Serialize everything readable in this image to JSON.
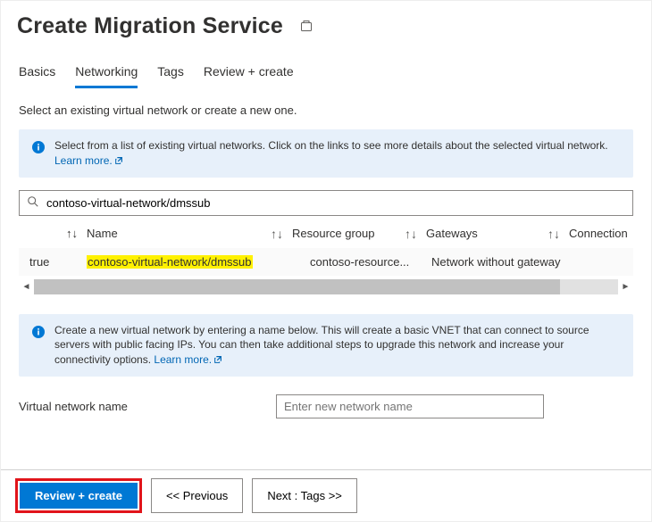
{
  "header": {
    "title": "Create Migration Service"
  },
  "tabs": {
    "basics": "Basics",
    "networking": "Networking",
    "tags": "Tags",
    "review": "Review + create"
  },
  "intro": "Select an existing virtual network or create a new one.",
  "info1": {
    "text": "Select from a list of existing virtual networks. Click on the links to see more details about the selected virtual network.",
    "link": "Learn more."
  },
  "search": {
    "value": "contoso-virtual-network/dmssub"
  },
  "table": {
    "headers": {
      "name": "Name",
      "rg": "Resource group",
      "gw": "Gateways",
      "conn": "Connections"
    },
    "row": {
      "col0": "true",
      "name": "contoso-virtual-network/dmssub",
      "rg": "contoso-resource...",
      "gw": "Network without gateway"
    }
  },
  "info2": {
    "text": "Create a new virtual network by entering a name below. This will create a basic VNET that can connect to source servers with public facing IPs. You can then take additional steps to upgrade this network and increase your connectivity options. ",
    "link": "Learn more."
  },
  "form": {
    "vnet_label": "Virtual network name",
    "vnet_placeholder": "Enter new network name"
  },
  "footer": {
    "review": "Review + create",
    "previous": "<< Previous",
    "next": "Next : Tags >>"
  }
}
